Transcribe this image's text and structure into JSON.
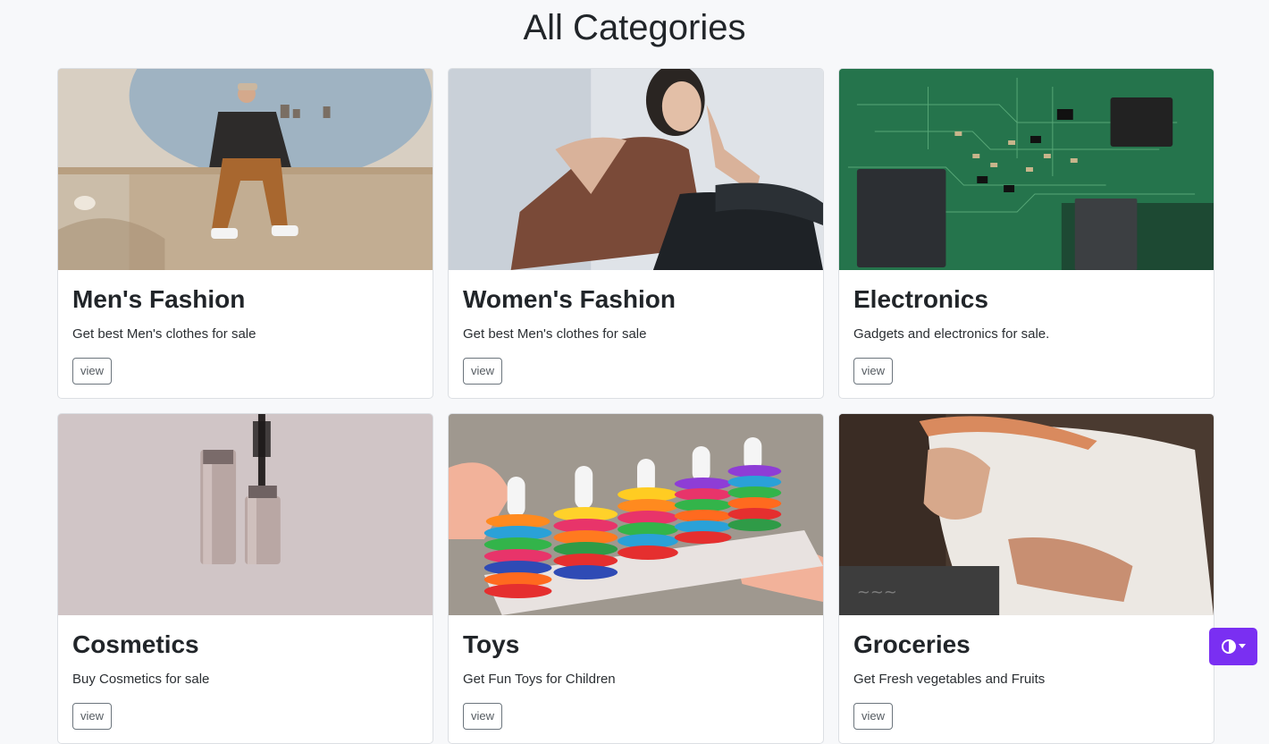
{
  "page": {
    "title": "All Categories"
  },
  "categories": [
    {
      "title": "Men's Fashion",
      "description": "Get best Men's clothes for sale",
      "button": "view",
      "image_icon": "man-sitting-photo"
    },
    {
      "title": "Women's Fashion",
      "description": "Get best Men's clothes for sale",
      "button": "view",
      "image_icon": "woman-sitting-photo"
    },
    {
      "title": "Electronics",
      "description": "Gadgets and electronics for sale.",
      "button": "view",
      "image_icon": "circuit-board-photo"
    },
    {
      "title": "Cosmetics",
      "description": "Buy Cosmetics for sale",
      "button": "view",
      "image_icon": "mascara-photo"
    },
    {
      "title": "Toys",
      "description": "Get Fun Toys for Children",
      "button": "view",
      "image_icon": "stacking-toy-photo"
    },
    {
      "title": "Groceries",
      "description": "Get Fresh vegetables and Fruits",
      "button": "view",
      "image_icon": "shrimp-hand-photo"
    }
  ],
  "theme_toggle": {
    "icon": "contrast-icon",
    "accent": "#7a2ff2"
  }
}
